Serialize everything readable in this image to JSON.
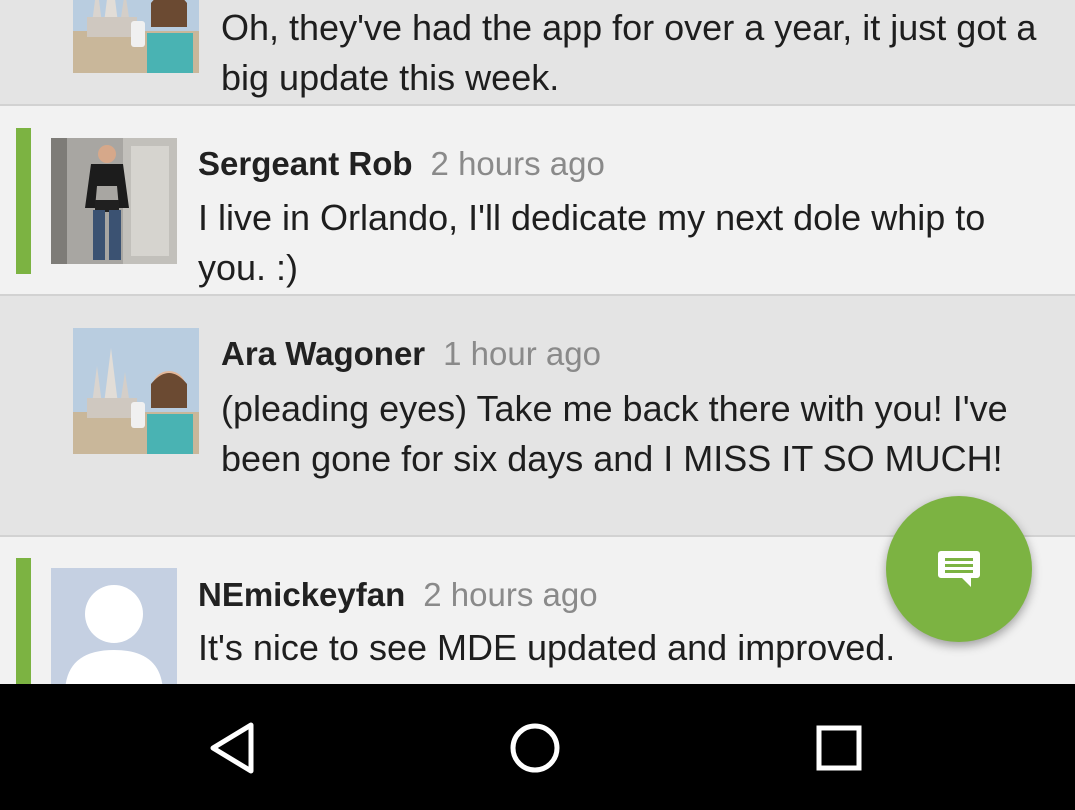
{
  "comments": [
    {
      "author": "",
      "time": "",
      "text": "Oh, they've had the app for over a year, it just got a big update this week.",
      "avatar_icon": "castle-photo-avatar"
    },
    {
      "author": "Sergeant Rob",
      "time": "2 hours ago",
      "text": "I live in Orlando, I'll dedicate my next dole whip to you. :)",
      "avatar_icon": "person-photo-avatar"
    },
    {
      "author": "Ara Wagoner",
      "time": "1 hour ago",
      "text": "(pleading eyes) Take me back there with you! I've been gone for six days and I MISS IT SO MUCH!",
      "avatar_icon": "castle-photo-avatar"
    },
    {
      "author": "NEmickeyfan",
      "time": "2 hours ago",
      "text": "It's nice to see MDE updated and improved.",
      "avatar_icon": "default-person-avatar"
    }
  ],
  "fab": {
    "icon": "comment-icon"
  },
  "navbar": {
    "back_icon": "back-triangle-icon",
    "home_icon": "home-circle-icon",
    "recents_icon": "recents-square-icon"
  },
  "colors": {
    "accent": "#7cb342",
    "reply_bg": "#e4e4e4",
    "top_bg": "#f2f2f2",
    "navbar": "#000000"
  }
}
